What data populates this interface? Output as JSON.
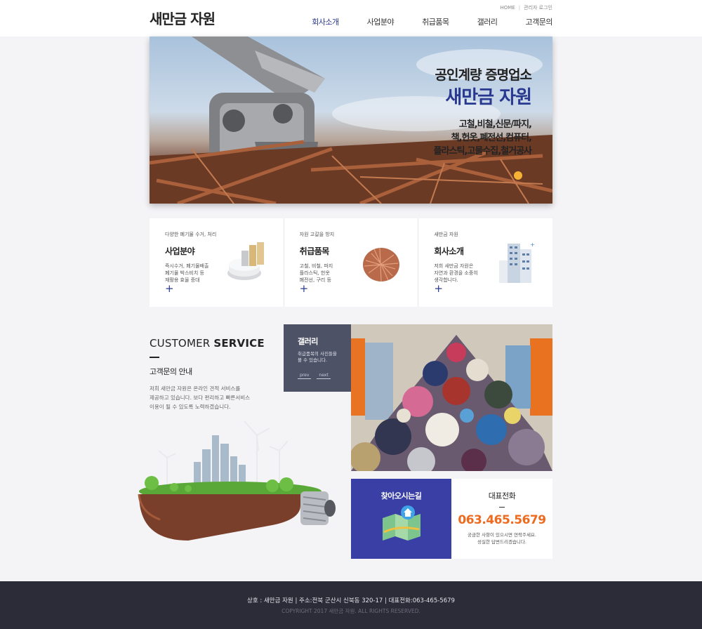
{
  "header": {
    "logo": "새만금 자원",
    "util": {
      "home": "HOME",
      "separator": "|",
      "admin": "관리자 로그인"
    },
    "nav": [
      "회사소개",
      "사업분야",
      "취급품목",
      "갤러리",
      "고객문의"
    ],
    "nav_active": "회사소개"
  },
  "hero": {
    "line1": "공인계량 증명업소",
    "line2": "새만금 자원",
    "items": [
      "고철,비철,신문/파지,",
      "책,헌옷,폐전선,컴퓨터,",
      "플라스틱,고물수집,철거공사"
    ]
  },
  "cards": [
    {
      "sub": "다양한 폐기물 수거, 처리",
      "title": "사업분야",
      "desc": "즉시수거, 폐기물배출\n폐기물 박스비치 등\n재활용 효율 증대",
      "plus": "+",
      "icon": "chart-3d-icon"
    },
    {
      "sub": "자원 고갈을 방지",
      "title": "취급품목",
      "desc": "고철, 비철, 파지\n플라스틱, 헌옷\n폐전선, 구리 등",
      "plus": "+",
      "icon": "copper-wire-icon"
    },
    {
      "sub": "새만금 자원",
      "title": "회사소개",
      "desc": "저희 새만금 자원은\n자연과 환경을 소중히\n생각합니다.",
      "plus": "+",
      "icon": "building-icon"
    }
  ],
  "customer": {
    "title_light": "CUSTOMER ",
    "title_bold": "SERVICE",
    "subtitle": "고객문의 안내",
    "desc": "저희 새만금 자원은 온라인 견적 서비스를\n제공하고 있습니다. 보다 편리하고 빠른서비스\n이용이 될 수 있도록 노력하겠습니다."
  },
  "gallery": {
    "title": "갤러리",
    "desc": "취급품목의 사진들을\n볼 수 있습니다.",
    "prev": "prev",
    "next": "next"
  },
  "directions": {
    "title": "찾아오시는길",
    "icon": "map-icon"
  },
  "phone": {
    "title": "대표전화",
    "number": "063.465.5679",
    "desc": "궁금한 사항이 있으시면 연락주세요.\n성실한 답변드리겠습니다."
  },
  "footer": {
    "info": "상호 : 새만금 자원  |  주소:전북 군산시 신북동 320-17  |  대표전화:063-465-5679",
    "copyright": "COPYRIGHT 2017 새만금 자원. ALL RIGHTS RESERVED."
  },
  "colors": {
    "accent": "#2a3990",
    "orange": "#ee6a1e",
    "footer": "#2b2c38",
    "gallery_box": "#4e5267",
    "directions_bg": "#3a3fa5"
  }
}
